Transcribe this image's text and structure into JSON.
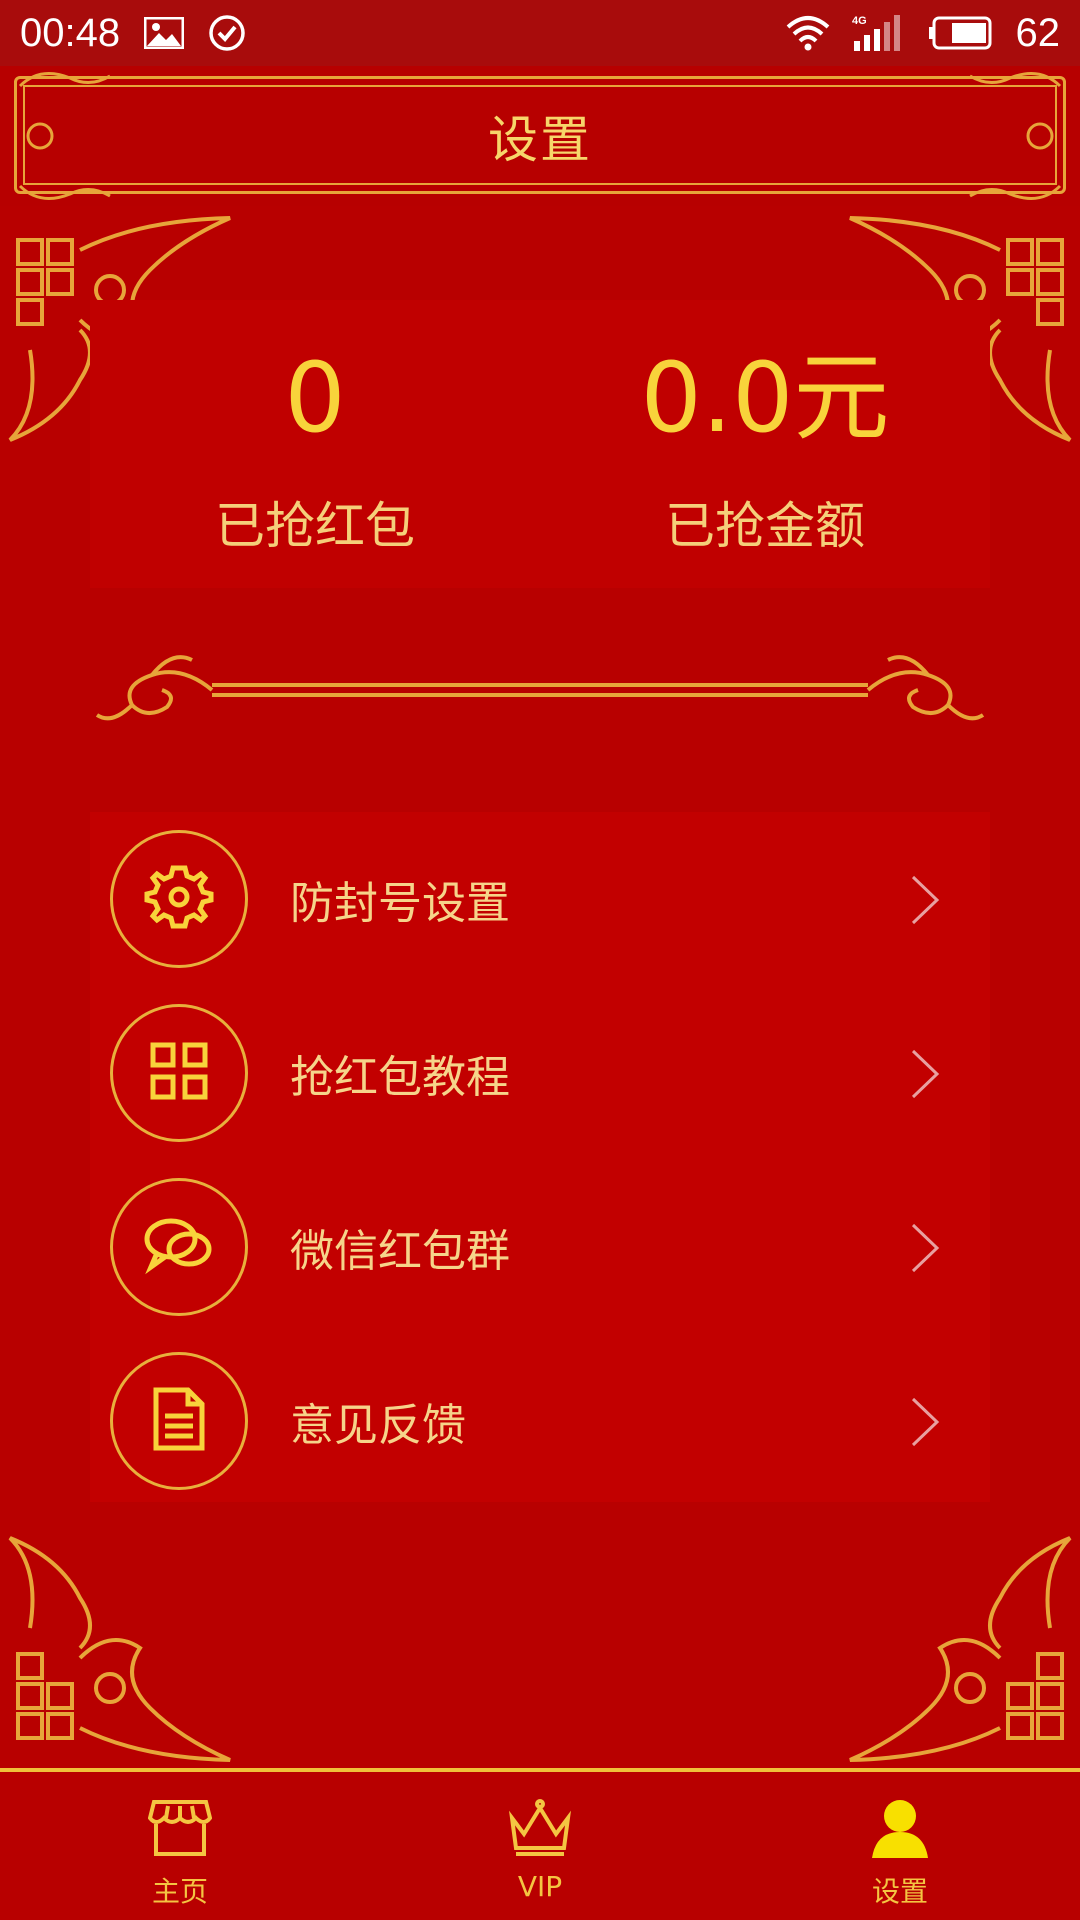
{
  "status_bar": {
    "time": "00:48",
    "battery": "62",
    "network": "4G"
  },
  "header": {
    "title": "设置"
  },
  "stats": {
    "grabbed_count": "0",
    "grabbed_count_label": "已抢红包",
    "grabbed_amount": "0.0元",
    "grabbed_amount_label": "已抢金额"
  },
  "menu": {
    "items": [
      {
        "label": "防封号设置",
        "icon": "gear-icon"
      },
      {
        "label": "抢红包教程",
        "icon": "grid-icon"
      },
      {
        "label": "微信红包群",
        "icon": "chat-icon"
      },
      {
        "label": "意见反馈",
        "icon": "document-icon"
      }
    ]
  },
  "tabs": [
    {
      "label": "主页",
      "icon": "shop-icon"
    },
    {
      "label": "VIP",
      "icon": "crown-icon"
    },
    {
      "label": "设置",
      "icon": "user-icon"
    }
  ],
  "colors": {
    "background": "#b80000",
    "gold": "#f4c542",
    "card": "#c00000"
  }
}
